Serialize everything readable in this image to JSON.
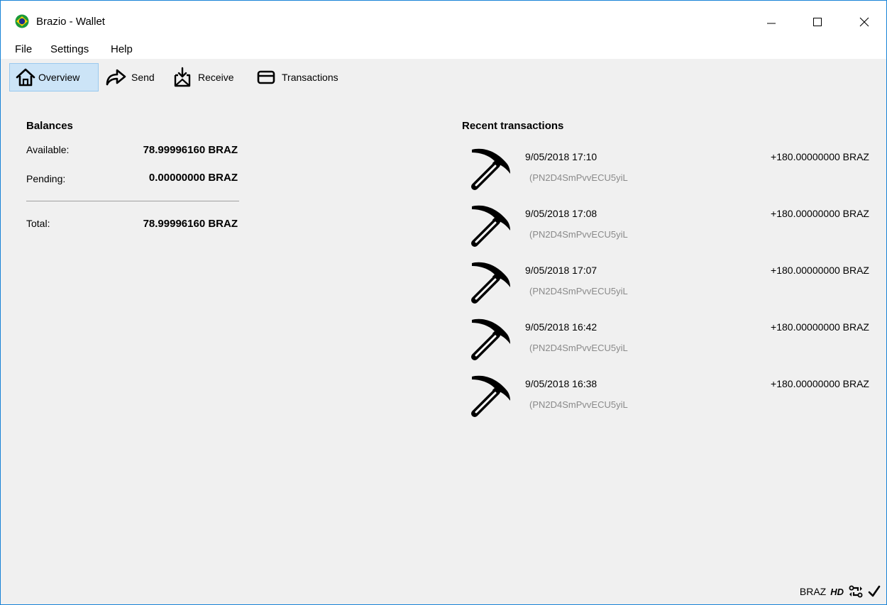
{
  "window": {
    "title": "Brazio - Wallet"
  },
  "menu": {
    "items": [
      "File",
      "Settings",
      "Help"
    ]
  },
  "toolbar": {
    "overview": "Overview",
    "send": "Send",
    "receive": "Receive",
    "transactions": "Transactions"
  },
  "balances": {
    "heading": "Balances",
    "available_label": "Available:",
    "available_value": "78.99996160 BRAZ",
    "pending_label": "Pending:",
    "pending_value": "0.00000000 BRAZ",
    "total_label": "Total:",
    "total_value": "78.99996160 BRAZ"
  },
  "recent": {
    "heading": "Recent transactions",
    "items": [
      {
        "date": "9/05/2018 17:10",
        "address": "(PN2D4SmPvvECU5yiL",
        "amount": "+180.00000000 BRAZ",
        "icon": "pickaxe-icon"
      },
      {
        "date": "9/05/2018 17:08",
        "address": "(PN2D4SmPvvECU5yiL",
        "amount": "+180.00000000 BRAZ",
        "icon": "pickaxe-icon"
      },
      {
        "date": "9/05/2018 17:07",
        "address": "(PN2D4SmPvvECU5yiL",
        "amount": "+180.00000000 BRAZ",
        "icon": "pickaxe-icon"
      },
      {
        "date": "9/05/2018 16:42",
        "address": "(PN2D4SmPvvECU5yiL",
        "amount": "+180.00000000 BRAZ",
        "icon": "pickaxe-icon"
      },
      {
        "date": "9/05/2018 16:38",
        "address": "(PN2D4SmPvvECU5yiL",
        "amount": "+180.00000000 BRAZ",
        "icon": "pickaxe-icon"
      }
    ]
  },
  "status": {
    "unit": "BRAZ",
    "hd": "HD"
  },
  "colors": {
    "window_border": "#1883d7",
    "active_tab_bg": "#cce4f7",
    "address_gray": "#8a8a8a"
  }
}
